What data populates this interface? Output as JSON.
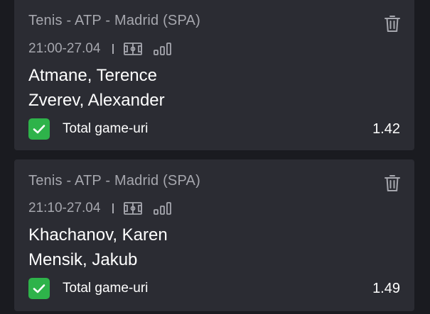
{
  "bets": [
    {
      "league": "Tenis - ATP - Madrid (SPA)",
      "time": "21:00-27.04",
      "team1": "Atmane, Terence",
      "team2": "Zverev, Alexander",
      "market": "Total game-uri",
      "odd": "1.42",
      "selected": true
    },
    {
      "league": "Tenis - ATP - Madrid (SPA)",
      "time": "21:10-27.04",
      "team1": "Khachanov, Karen",
      "team2": "Mensik, Jakub",
      "market": "Total game-uri",
      "odd": "1.49",
      "selected": true
    }
  ],
  "icons": {
    "delete": "trash-icon",
    "field": "field-icon",
    "stats": "stats-icon",
    "check": "checkmark-icon"
  },
  "colors": {
    "card_background": "#2b2c33",
    "page_background": "#1a1b20",
    "muted_text": "#a6a7ae",
    "check_green": "#2eb34a"
  }
}
